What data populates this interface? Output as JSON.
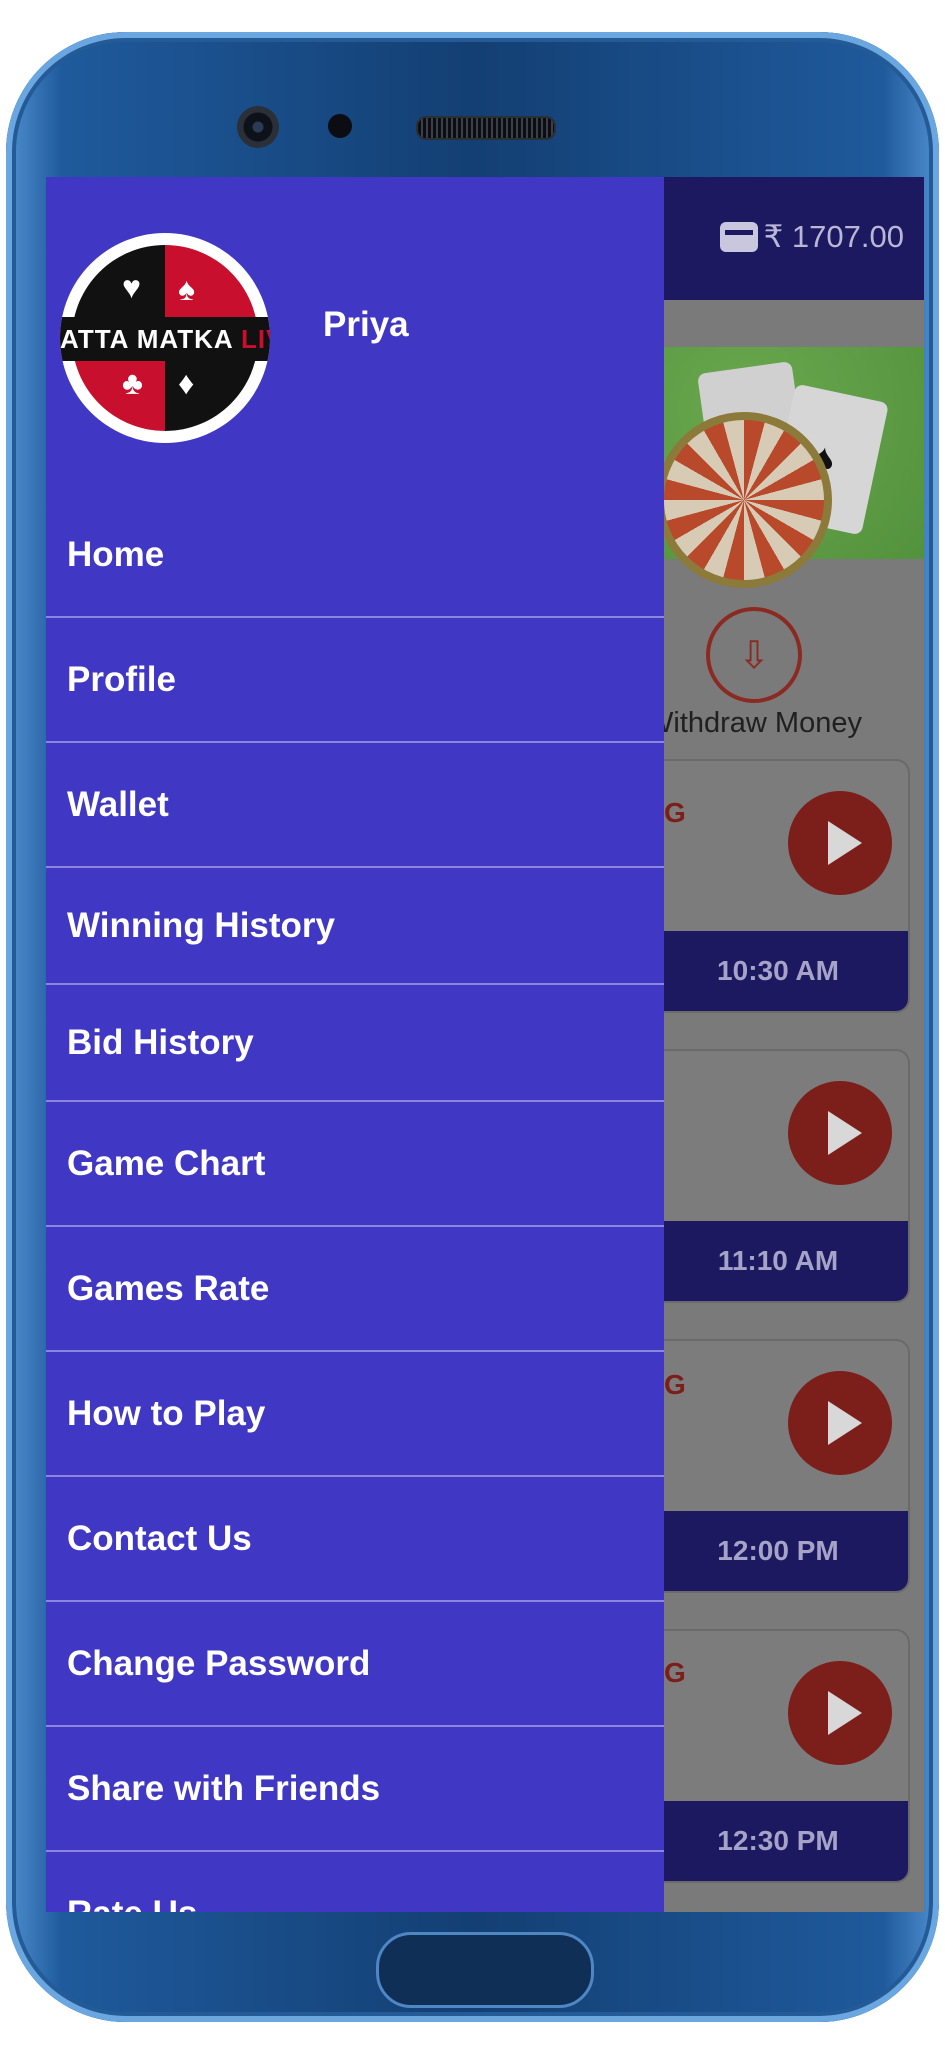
{
  "header": {
    "wallet_balance": "₹ 1707.00",
    "wallet_icon": "wallet-icon"
  },
  "home": {
    "withdraw_label": "Withdraw Money",
    "withdraw_icon": "download-tray-icon",
    "games": [
      {
        "time": "10:30 AM",
        "letter": "G"
      },
      {
        "time": "11:10 AM",
        "letter": ""
      },
      {
        "time": "12:00 PM",
        "letter": "G"
      },
      {
        "time": "12:30 PM",
        "letter": "G"
      }
    ]
  },
  "drawer": {
    "logo_text": "ATTA MATKA",
    "logo_text_accent": "LIV",
    "user_name": "Priya",
    "menu": [
      {
        "label": "Home"
      },
      {
        "label": "Profile"
      },
      {
        "label": "Wallet"
      },
      {
        "label": "Winning History"
      },
      {
        "label": "Bid History"
      },
      {
        "label": "Game Chart"
      },
      {
        "label": "Games Rate"
      },
      {
        "label": "How to Play"
      },
      {
        "label": "Contact Us"
      },
      {
        "label": "Change Password"
      },
      {
        "label": "Share with Friends"
      },
      {
        "label": "Rate Us"
      }
    ]
  },
  "colors": {
    "drawer_bg": "#4038c4",
    "topbar": "#1d1960",
    "accent_red": "#c0392b"
  }
}
